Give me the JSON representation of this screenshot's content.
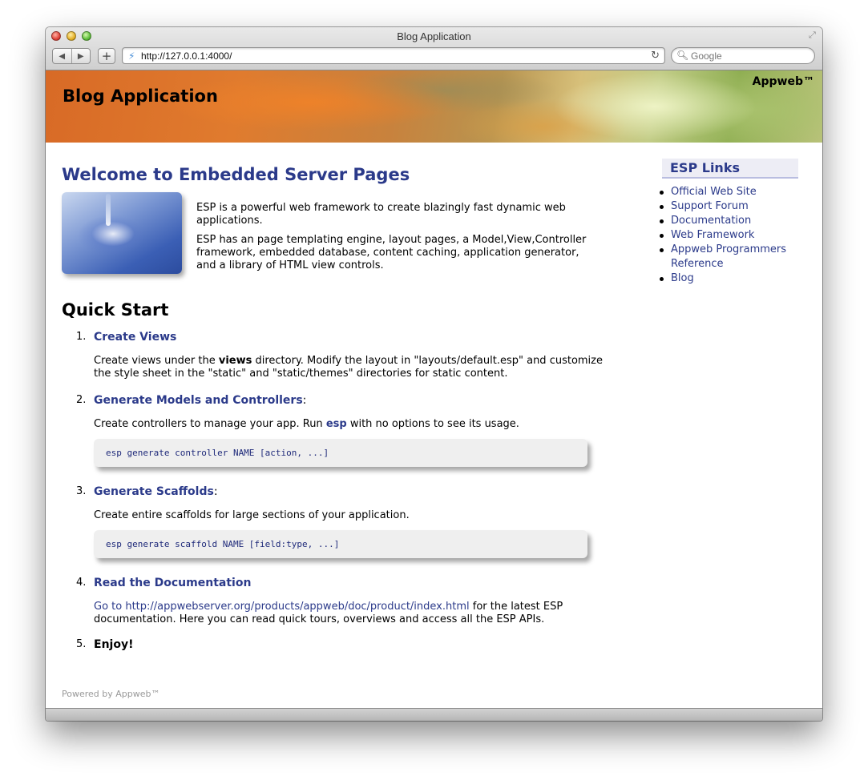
{
  "window": {
    "title": "Blog Application",
    "url": "http://127.0.0.1:4000/",
    "search_placeholder": "Google"
  },
  "icons": {
    "back": "◀",
    "forward": "▶",
    "add": "+",
    "site": "⚡",
    "reload": "↻",
    "search": "🔍︎",
    "resize": "⤢"
  },
  "banner": {
    "title": "Blog Application",
    "brand": "Appweb™"
  },
  "main": {
    "heading": "Welcome to Embedded Server Pages",
    "intro_p1": "ESP is a powerful web framework to create blazingly fast dynamic web applications.",
    "intro_p2": "ESP has an page templating engine, layout pages, a Model,View,Controller framework, embedded database, content caching, application generator, and a library of HTML view controls.",
    "quick_start": "Quick Start",
    "steps": [
      {
        "num": "1.",
        "title": "Create Views",
        "body_pre": "Create views under the ",
        "body_kw": "views",
        "body_post": " directory. Modify the layout in \"layouts/default.esp\" and customize the style sheet in the \"static\" and \"static/themes\" directories for static content."
      },
      {
        "num": "2.",
        "title": "Generate Models and Controllers",
        "suffix": ":",
        "body_pre": "Create controllers to manage your app. Run ",
        "body_kw": "esp",
        "body_post": " with no options to see its usage.",
        "code": "esp generate controller NAME [action, ...]"
      },
      {
        "num": "3.",
        "title": "Generate Scaffolds",
        "suffix": ":",
        "body": "Create entire scaffolds for large sections of your application.",
        "code": "esp generate scaffold NAME [field:type, ...]"
      },
      {
        "num": "4.",
        "title": "Read the Documentation",
        "link": "Go to http://appwebserver.org/products/appweb/doc/product/index.html",
        "body_post": " for the latest ESP documentation. Here you can read quick tours, overviews and access all the ESP APIs."
      },
      {
        "num": "5.",
        "title": "Enjoy!"
      }
    ],
    "footer": "Powered by Appweb™"
  },
  "sidebar": {
    "title": "ESP Links",
    "links": [
      "Official Web Site",
      "Support Forum",
      "Documentation",
      "Web Framework",
      "Appweb Programmers Reference",
      "Blog"
    ]
  }
}
